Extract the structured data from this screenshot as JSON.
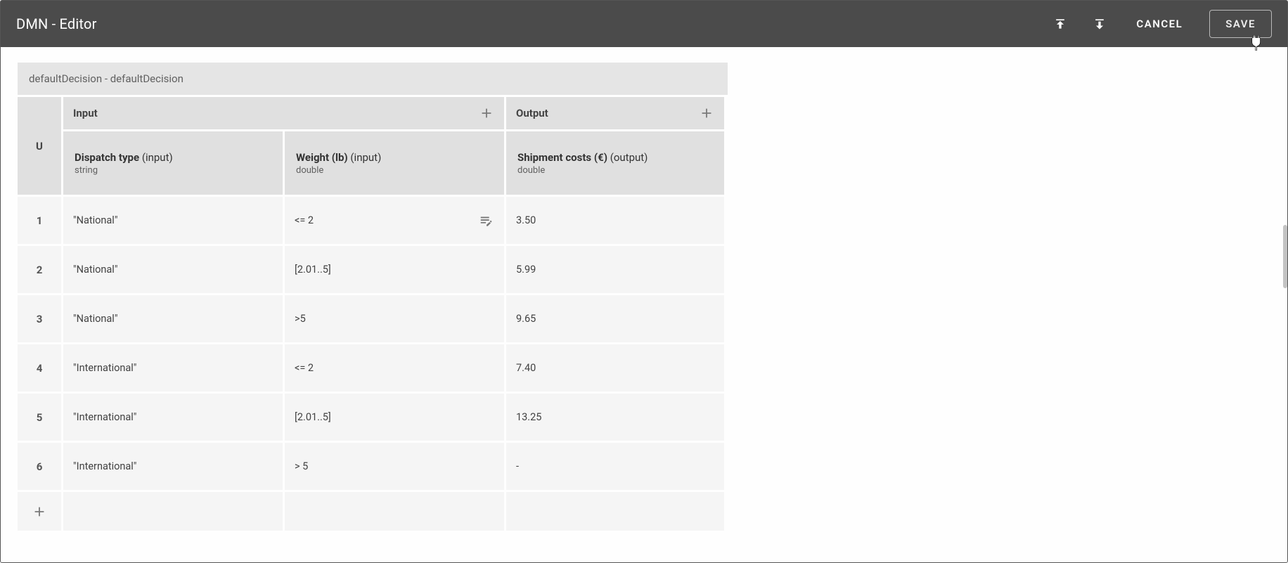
{
  "toolbar": {
    "title": "DMN - Editor",
    "cancel_label": "CANCEL",
    "save_label": "SAVE"
  },
  "decision": {
    "caption": "defaultDecision - defaultDecision",
    "hit_policy": "U",
    "input_group_label": "Input",
    "output_group_label": "Output",
    "columns": [
      {
        "name": "Dispatch type",
        "role": "(input)",
        "type": "string"
      },
      {
        "name": "Weight (lb)",
        "role": "(input)",
        "type": "double"
      },
      {
        "name": "Shipment costs (€)",
        "role": "(output)",
        "type": "double"
      }
    ],
    "rows": [
      {
        "num": "1",
        "c0": "\"National\"",
        "c1": "<= 2",
        "c2": "3.50"
      },
      {
        "num": "2",
        "c0": "\"National\"",
        "c1": "[2.01..5]",
        "c2": "5.99"
      },
      {
        "num": "3",
        "c0": "\"National\"",
        "c1": ">5",
        "c2": "9.65"
      },
      {
        "num": "4",
        "c0": "\"International\"",
        "c1": "<= 2",
        "c2": "7.40"
      },
      {
        "num": "5",
        "c0": "\"International\"",
        "c1": "[2.01..5]",
        "c2": "13.25"
      },
      {
        "num": "6",
        "c0": "\"International\"",
        "c1": "> 5",
        "c2": "-"
      }
    ]
  }
}
